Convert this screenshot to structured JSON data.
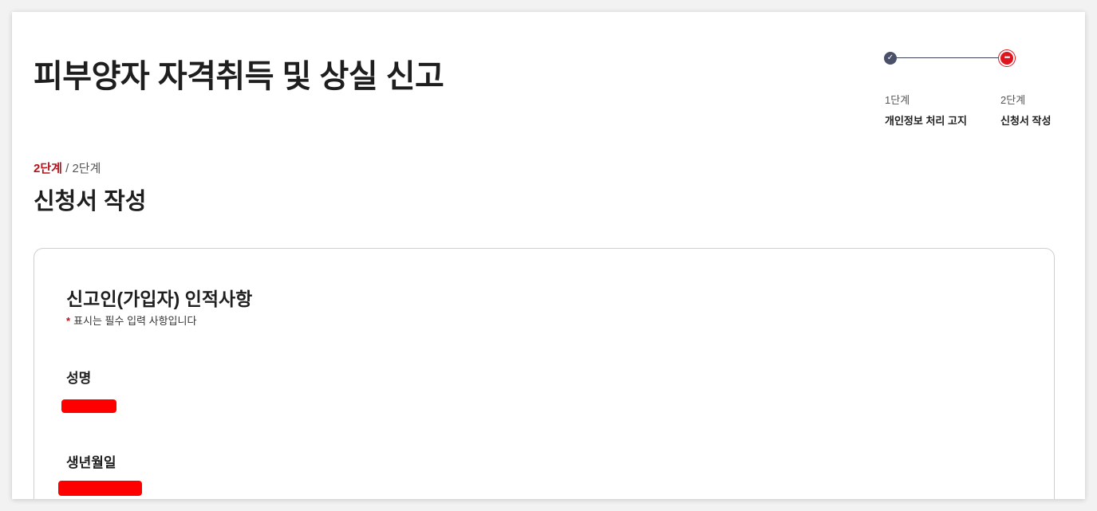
{
  "page": {
    "title": "피부양자 자격취득 및 상실 신고"
  },
  "stepper": {
    "steps": [
      {
        "number": "1단계",
        "name": "개인정보 처리 고지",
        "status": "done",
        "icon": "check-icon"
      },
      {
        "number": "2단계",
        "name": "신청서 작성",
        "status": "current",
        "icon": "more-icon"
      }
    ],
    "done_mark": "✓",
    "current_mark": "•••"
  },
  "section": {
    "step_current": "2단계",
    "step_separator": " / ",
    "step_total": "2단계",
    "title": "신청서 작성"
  },
  "form": {
    "card_title": "신고인(가입자) 인적사항",
    "required_star": "*",
    "required_note": "표시는 필수 입력 사항입니다",
    "fields": [
      {
        "label": "성명",
        "value": "[redacted]"
      },
      {
        "label": "생년월일",
        "value": "[redacted]"
      }
    ]
  },
  "colors": {
    "accent": "#b5121b",
    "active_step": "#e0141e",
    "done_step": "#4a5068",
    "redaction": "#ff0000"
  }
}
